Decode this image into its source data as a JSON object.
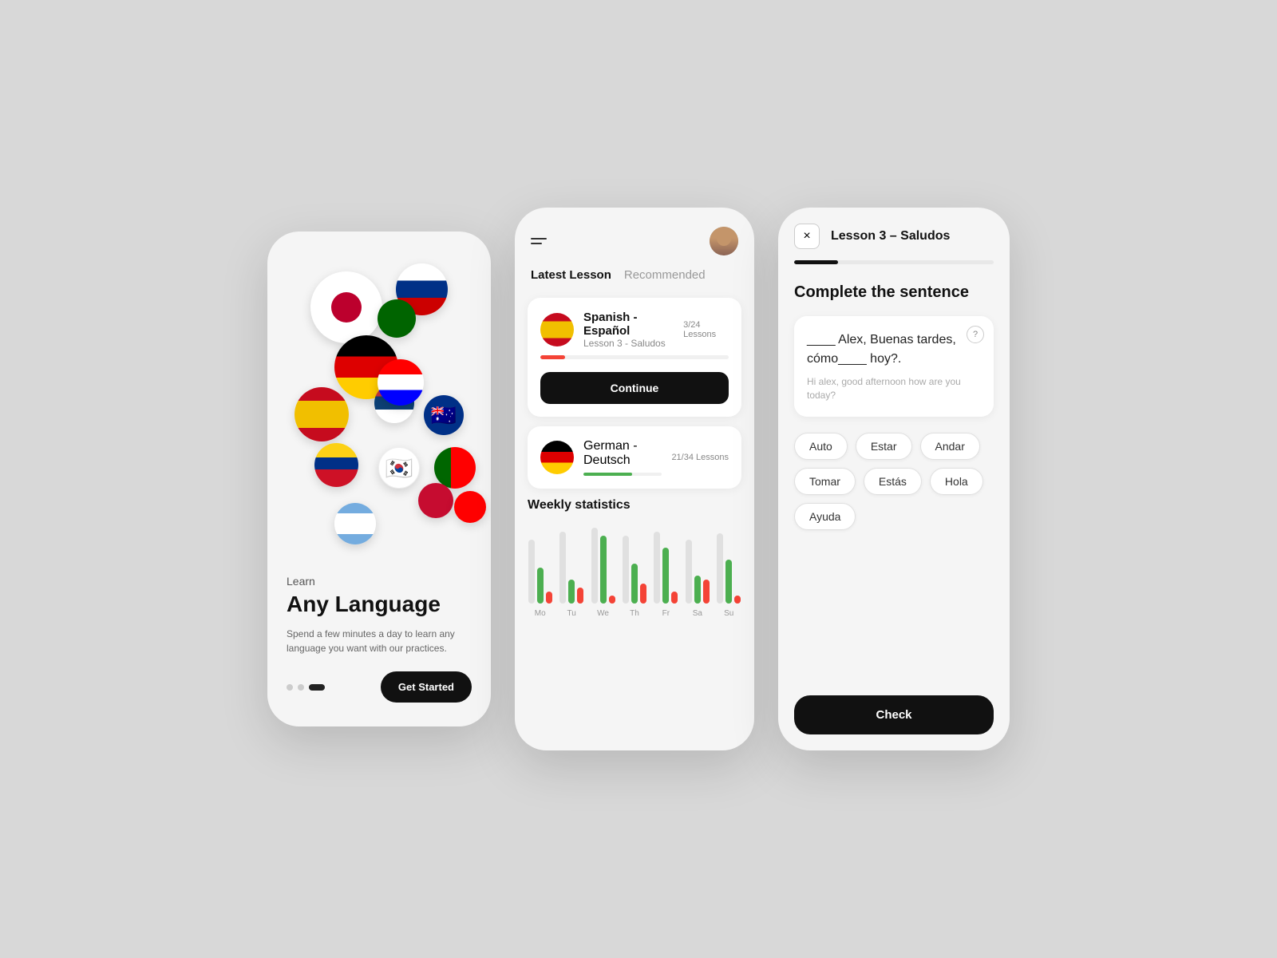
{
  "background": "#d8d8d8",
  "phone1": {
    "sub_label": "Learn",
    "title": "Any Language",
    "description": "Spend a few minutes a day to learn any language you want with our practices.",
    "dots": [
      "inactive",
      "inactive",
      "active"
    ],
    "cta_label": "Get Started"
  },
  "phone2": {
    "tabs": [
      {
        "label": "Latest Lesson",
        "active": true
      },
      {
        "label": "Recommended",
        "active": false
      }
    ],
    "spanish_card": {
      "language": "Spanish - Español",
      "lesson": "Lesson 3 - Saludos",
      "progress_label": "3/24 Lessons",
      "progress_pct": 13,
      "progress_color": "#F44336",
      "continue_label": "Continue"
    },
    "german_card": {
      "language": "German - Deutsch",
      "progress_label": "21/34 Lessons",
      "progress_pct": 62,
      "progress_color": "#4CAF50"
    },
    "stats": {
      "title": "Weekly statistics",
      "days": [
        "Mo",
        "Tu",
        "We",
        "Th",
        "Fr",
        "Sa",
        "Su"
      ],
      "green_heights": [
        45,
        30,
        85,
        50,
        70,
        35,
        55
      ],
      "red_heights": [
        15,
        20,
        10,
        25,
        15,
        30,
        10
      ],
      "gray_heights": [
        80,
        90,
        95,
        85,
        90,
        80,
        88
      ]
    }
  },
  "phone3": {
    "header_title": "Lesson 3 – Saludos",
    "close_icon": "×",
    "progress_pct": 22,
    "section_title": "Complete the sentence",
    "sentence": "____ Alex, Buenas tardes, cómo____ hoy?.",
    "translation": "Hi alex, good afternoon how are you today?",
    "help_icon": "?",
    "word_options": [
      "Auto",
      "Estar",
      "Andar",
      "Tomar",
      "Estás",
      "Hola",
      "Ayuda"
    ],
    "check_label": "Check"
  }
}
